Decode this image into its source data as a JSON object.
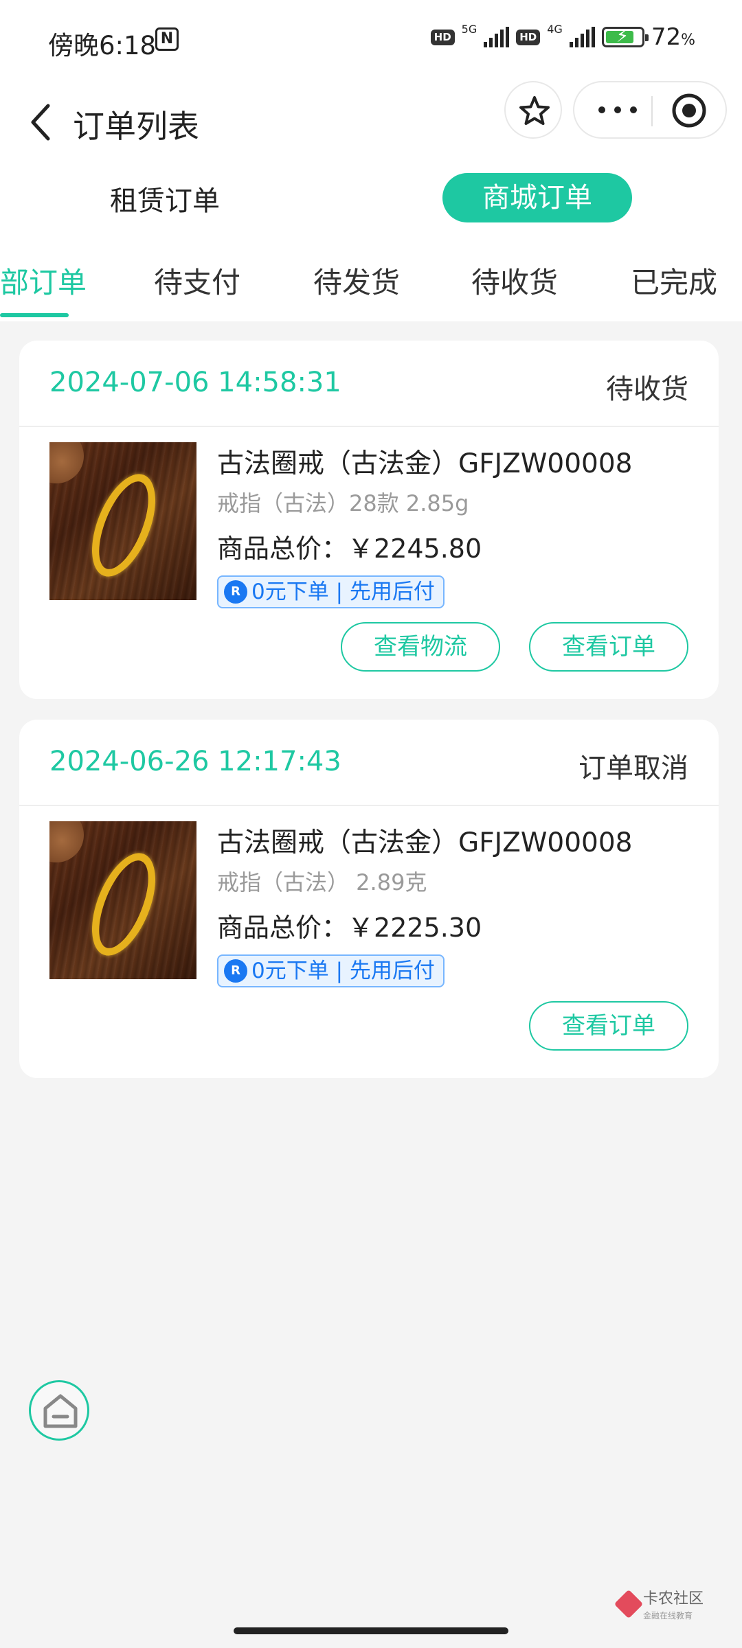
{
  "status_bar": {
    "time": "傍晚6:18",
    "nfc_label": "N",
    "hd1": "HD",
    "net1": "5G",
    "hd2": "HD",
    "net2": "4G",
    "battery_percent": "72",
    "battery_unit": "%"
  },
  "header": {
    "title": "订单列表",
    "icons": [
      "back-icon",
      "star-icon",
      "more-icon",
      "target-icon"
    ]
  },
  "order_type": {
    "rent_label": "租赁订单",
    "mall_label": "商城订单",
    "active": "mall"
  },
  "tabs": [
    {
      "label": "部订单",
      "active": true
    },
    {
      "label": "待支付",
      "active": false
    },
    {
      "label": "待发货",
      "active": false
    },
    {
      "label": "待收货",
      "active": false
    },
    {
      "label": "已完成",
      "active": false
    }
  ],
  "orders": [
    {
      "time": "2024-07-06 14:58:31",
      "status": "待收货",
      "product_name": "古法圈戒（古法金）GFJZW00008",
      "spec": "戒指（古法）28款 2.85g",
      "price_label": "商品总价：",
      "price": "￥2245.80",
      "promo_icon": "R",
      "promo": "0元下单 | 先用后付",
      "buttons": [
        "查看物流",
        "查看订单"
      ]
    },
    {
      "time": "2024-06-26 12:17:43",
      "status": "订单取消",
      "product_name": "古法圈戒（古法金）GFJZW00008",
      "spec": "戒指（古法） 2.89克",
      "price_label": "商品总价：",
      "price": "￥2225.30",
      "promo_icon": "R",
      "promo": "0元下单 | 先用后付",
      "buttons": [
        "查看订单"
      ]
    }
  ],
  "watermark": {
    "name": "卡农社区",
    "sub": "金融在线教育"
  },
  "colors": {
    "accent": "#1ec8a2",
    "promo_blue": "#1a78f2",
    "background": "#f4f4f4"
  }
}
